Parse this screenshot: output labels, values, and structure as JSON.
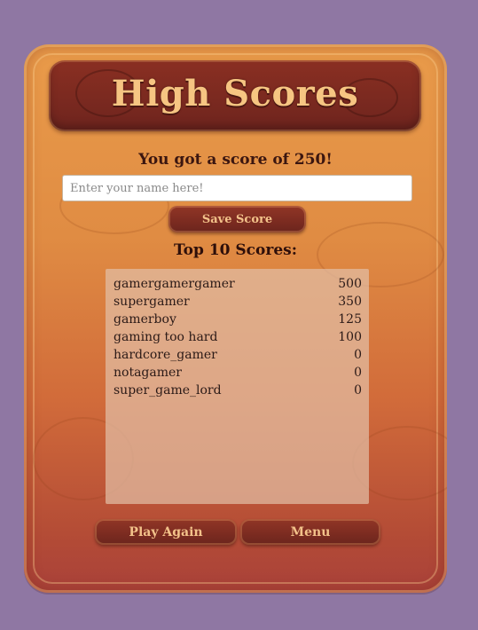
{
  "title": "High Scores",
  "score_message": "You got a score of 250!",
  "name_input": {
    "placeholder": "Enter your name here!",
    "value": ""
  },
  "save_label": "Save Score",
  "top_heading": "Top 10 Scores:",
  "scores": [
    {
      "name": "gamergamergamer",
      "score": "500"
    },
    {
      "name": "supergamer",
      "score": "350"
    },
    {
      "name": "gamerboy",
      "score": "125"
    },
    {
      "name": "gaming too hard",
      "score": "100"
    },
    {
      "name": "hardcore_gamer",
      "score": "0"
    },
    {
      "name": "notagamer",
      "score": "0"
    },
    {
      "name": "super_game_lord",
      "score": "0"
    }
  ],
  "play_again_label": "Play Again",
  "menu_label": "Menu",
  "colors": {
    "background": "#8f77a3",
    "board_top": "#e99b4a",
    "board_bottom": "#a9413a",
    "plank": "#7c2a20",
    "title_text": "#f6c582",
    "button_text": "#f3c28a"
  }
}
